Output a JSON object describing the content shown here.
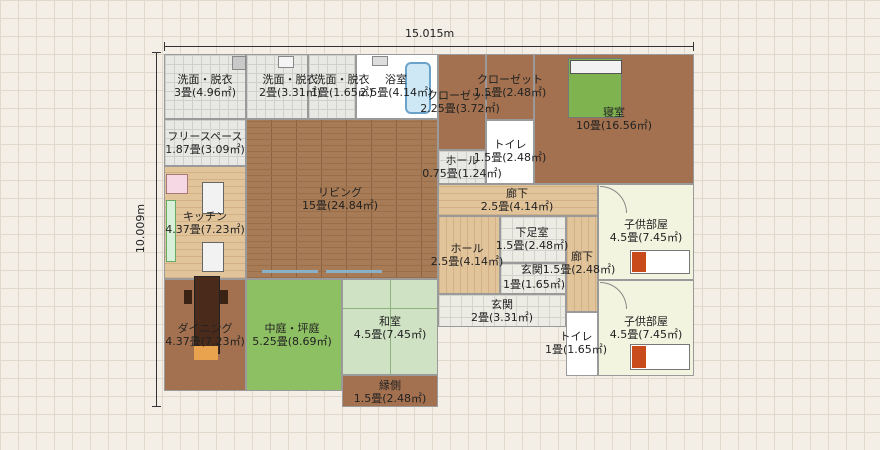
{
  "dimensions": {
    "width": "15.015m",
    "height": "10.009m"
  },
  "rooms": [
    {
      "name": "洗面・脱衣",
      "area": "3畳(4.96㎡)"
    },
    {
      "name": "洗面・脱衣",
      "area": "2畳(3.31㎡)"
    },
    {
      "name": "洗面・脱衣",
      "area": "1畳(1.65㎡)"
    },
    {
      "name": "浴室",
      "area": "2.5畳(4.14㎡)"
    },
    {
      "name": "クローゼット",
      "area": "2.25畳(3.72㎡)"
    },
    {
      "name": "クローゼット",
      "area": "1.5畳(2.48㎡)"
    },
    {
      "name": "寝室",
      "area": "10畳(16.56㎡)"
    },
    {
      "name": "フリースペース",
      "area": "1.87畳(3.09㎡)"
    },
    {
      "name": "トイレ",
      "area": "1.5畳(2.48㎡)"
    },
    {
      "name": "ホール",
      "area": "0.75畳(1.24㎡)"
    },
    {
      "name": "リビング",
      "area": "15畳(24.84㎡)"
    },
    {
      "name": "廊下",
      "area": "2.5畳(4.14㎡)"
    },
    {
      "name": "キッチン",
      "area": "4.37畳(7.23㎡)"
    },
    {
      "name": "子供部屋",
      "area": "4.5畳(7.45㎡)"
    },
    {
      "name": "ホール",
      "area": "2.5畳(4.14㎡)"
    },
    {
      "name": "下足室",
      "area": "1.5畳(2.48㎡)"
    },
    {
      "name": "廊下",
      "area": ""
    },
    {
      "name": "玄関",
      "area": "1.5畳(2.48㎡)"
    },
    {
      "name": "",
      "area": "1畳(1.65㎡)"
    },
    {
      "name": "玄関",
      "area": "2畳(3.31㎡)"
    },
    {
      "name": "ダイニング",
      "area": "4.37畳(7.23㎡)"
    },
    {
      "name": "中庭・坪庭",
      "area": "5.25畳(8.69㎡)"
    },
    {
      "name": "和室",
      "area": "4.5畳(7.45㎡)"
    },
    {
      "name": "子供部屋",
      "area": "4.5畳(7.45㎡)"
    },
    {
      "name": "トイレ",
      "area": "1畳(1.65㎡)"
    },
    {
      "name": "縁側",
      "area": "1.5畳(2.48㎡)"
    }
  ]
}
